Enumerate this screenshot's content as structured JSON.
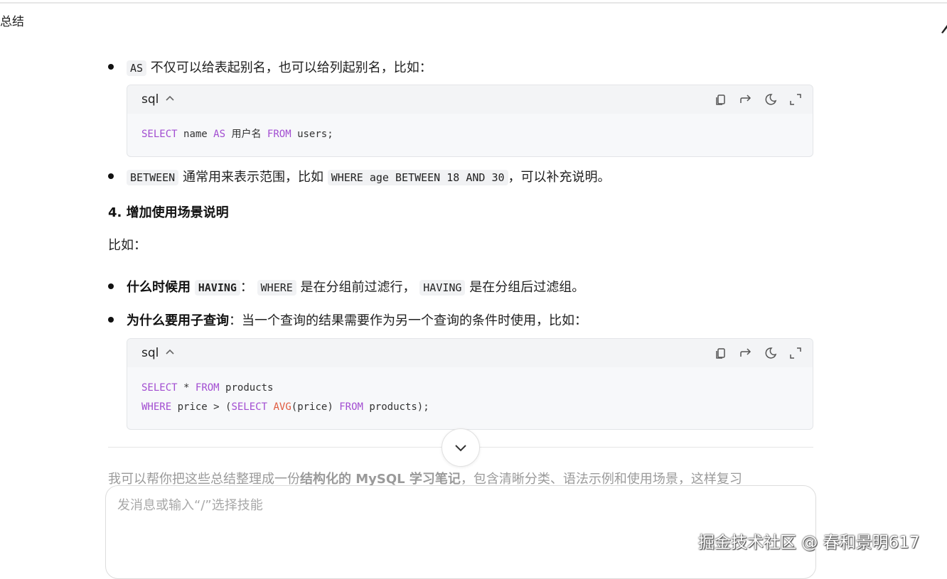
{
  "header": {
    "fragment": "总结"
  },
  "items": {
    "as_note": {
      "code": "AS",
      "text": "不仅可以给表起别名，也可以给列起别名，比如："
    },
    "code1": {
      "lang": "sql"
    },
    "between_note": {
      "code1": "BETWEEN",
      "text1": "通常用来表示范围，比如",
      "code2": "WHERE age BETWEEN 18 AND 30",
      "text2": "，可以补充说明。"
    },
    "section_heading": "4. 增加使用场景说明",
    "intro": "比如：",
    "having_note": {
      "bold": "什么时候用",
      "code1": "HAVING",
      "colon": "：",
      "code2": "WHERE",
      "text1": "是在分组前过滤行，",
      "code3": "HAVING",
      "text2": "是在分组后过滤组。"
    },
    "subquery_note": {
      "bold": "为什么要用子查询",
      "text": "：当一个查询的结果需要作为另一个查询的条件时使用，比如："
    },
    "code2": {
      "lang": "sql"
    }
  },
  "code_tokens": {
    "select": "SELECT",
    "name": "name",
    "as": "AS",
    "alias": "用户名",
    "from": "FROM",
    "users": "users;",
    "star": "*",
    "products": "products",
    "where": "WHERE",
    "price_gt": "price > (",
    "avg": "AVG",
    "price_paren": "(price)",
    "products_end": "products);"
  },
  "followup": {
    "text1": "我可以帮你把这些总结整理成一份",
    "bold": "结构化的 MySQL 学习笔记",
    "text2": "，包含清晰分类、语法示例和使用场景，这样复习"
  },
  "composer": {
    "placeholder": "发消息或输入“/”选择技能"
  },
  "watermark": "掘金技术社区 @ 春和景明617",
  "icons": {
    "header": "pen-icon",
    "code_tools": [
      "copy-icon",
      "share-icon",
      "theme-icon",
      "expand-icon"
    ],
    "collapse": "chevron-up-icon",
    "scroll": "chevron-down-icon"
  }
}
